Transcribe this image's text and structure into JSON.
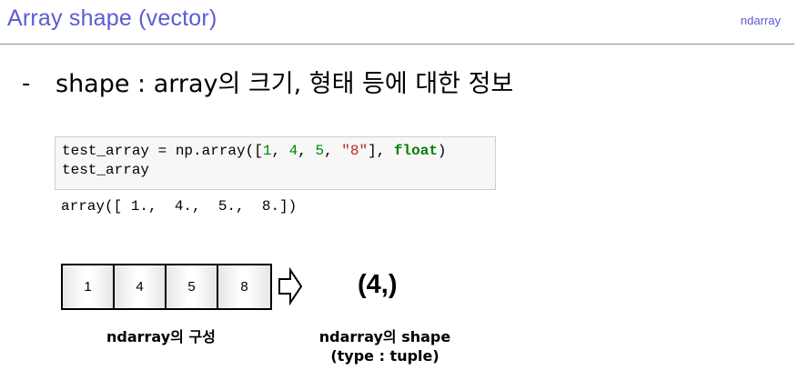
{
  "header": {
    "title": "Array shape (vector)",
    "tag": "ndarray"
  },
  "bullet": {
    "dash": "-",
    "text": "shape : array의 크기, 형태 등에 대한 정보"
  },
  "code": {
    "input_lines": [
      "test_array = np.array([1, 4, 5, \"8\"], float)",
      "test_array"
    ],
    "output": "array([ 1.,  4.,  5.,  8.])"
  },
  "diagram": {
    "array_values": [
      "1",
      "4",
      "5",
      "8"
    ],
    "shape_result": "(4,)",
    "caption_left": "ndarray의 구성",
    "caption_right_line1": "ndarray의 shape",
    "caption_right_line2": "(type : tuple)"
  },
  "colors": {
    "title": "#5b5bd6",
    "number": "#008800",
    "string": "#ba2121",
    "keyword": "#008000"
  }
}
